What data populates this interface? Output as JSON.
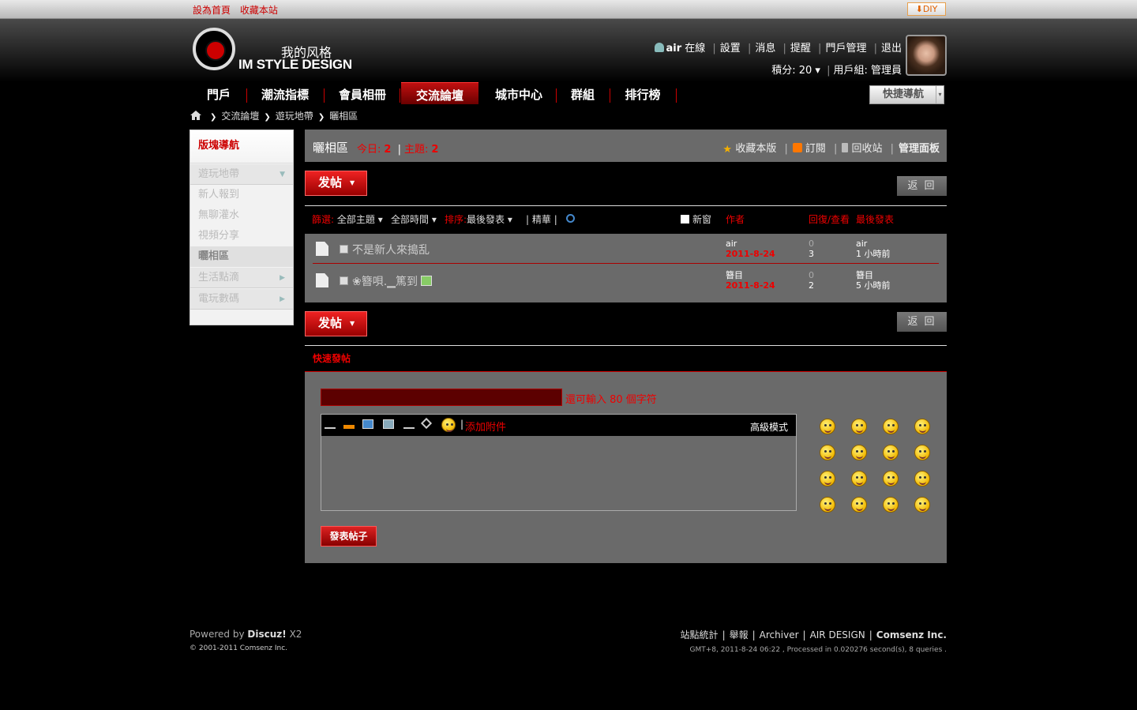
{
  "topbar": {
    "set_home": "設為首頁",
    "bookmark": "收藏本站",
    "diy": "DIY"
  },
  "logo": {
    "cn": "我的风格",
    "en": "IM STYLE DESIGN"
  },
  "user": {
    "name": "air",
    "online": "在線",
    "settings": "設置",
    "messages": "消息",
    "reminders": "提醒",
    "portal_admin": "門戶管理",
    "logout": "退出",
    "points_label": "積分: 20",
    "group_label": "用戶組: 管理員"
  },
  "nav": {
    "items": [
      "門戶",
      "潮流指標",
      "會員相冊",
      "交流論壇",
      "城市中心",
      "群組",
      "排行榜"
    ],
    "active": "交流論壇",
    "quick": "快捷導航"
  },
  "breadcrumb": [
    "交流論壇",
    "遊玩地帶",
    "曬相區"
  ],
  "sidebar": {
    "title": "版塊導航",
    "group1": "遊玩地帶",
    "subs": [
      "新人報到",
      "無聊灌水",
      "視頻分享",
      "曬相區"
    ],
    "group2": "生活點滴",
    "group3": "電玩數碼"
  },
  "forum": {
    "name": "曬相區",
    "today_label": "今日:",
    "today": "2",
    "topics_label": "主題:",
    "topics": "2",
    "fav": "收藏本版",
    "rss": "訂閱",
    "recycle": "回收站",
    "admin": "管理面板"
  },
  "buttons": {
    "post": "发帖",
    "back": "返 回"
  },
  "filter": {
    "label": "篩選:",
    "all_topics": "全部主題",
    "all_time": "全部時間",
    "sort_label": "排序:",
    "sort_value": "最後發表",
    "digest": "精華",
    "new_window": "新窗",
    "author": "作者",
    "reply_view": "回復/查看",
    "last_post": "最後發表"
  },
  "threads": [
    {
      "subject": "不是新人來搗乱",
      "author": "air",
      "date": "2011-8-24",
      "replies": "0",
      "views": "3",
      "last_user": "air",
      "last_time": "1 小時前"
    },
    {
      "subject": "❀簪唄.▁篤到",
      "author": "簪目",
      "date": "2011-8-24",
      "replies": "0",
      "views": "2",
      "last_user": "簪目",
      "last_time": "5 小時前"
    }
  ],
  "quick": {
    "title": "快速發帖",
    "tip": "還可輸入 80 個字符",
    "attach": "添加附件",
    "advanced": "高級模式",
    "submit": "發表帖子"
  },
  "footer": {
    "powered": "Powered by",
    "discuz": "Discuz!",
    "version": "X2",
    "copyright": "© 2001-2011 Comsenz Inc.",
    "links": [
      "站點統計",
      "舉報",
      "Archiver",
      "AIR DESIGN"
    ],
    "comsenz": "Comsenz Inc.",
    "stats": "GMT+8, 2011-8-24 06:22 , Processed in 0.020276 second(s), 8 queries ."
  },
  "colors": {
    "accent": "#cc0000",
    "panel": "#6a6a6a",
    "background": "#000000"
  }
}
